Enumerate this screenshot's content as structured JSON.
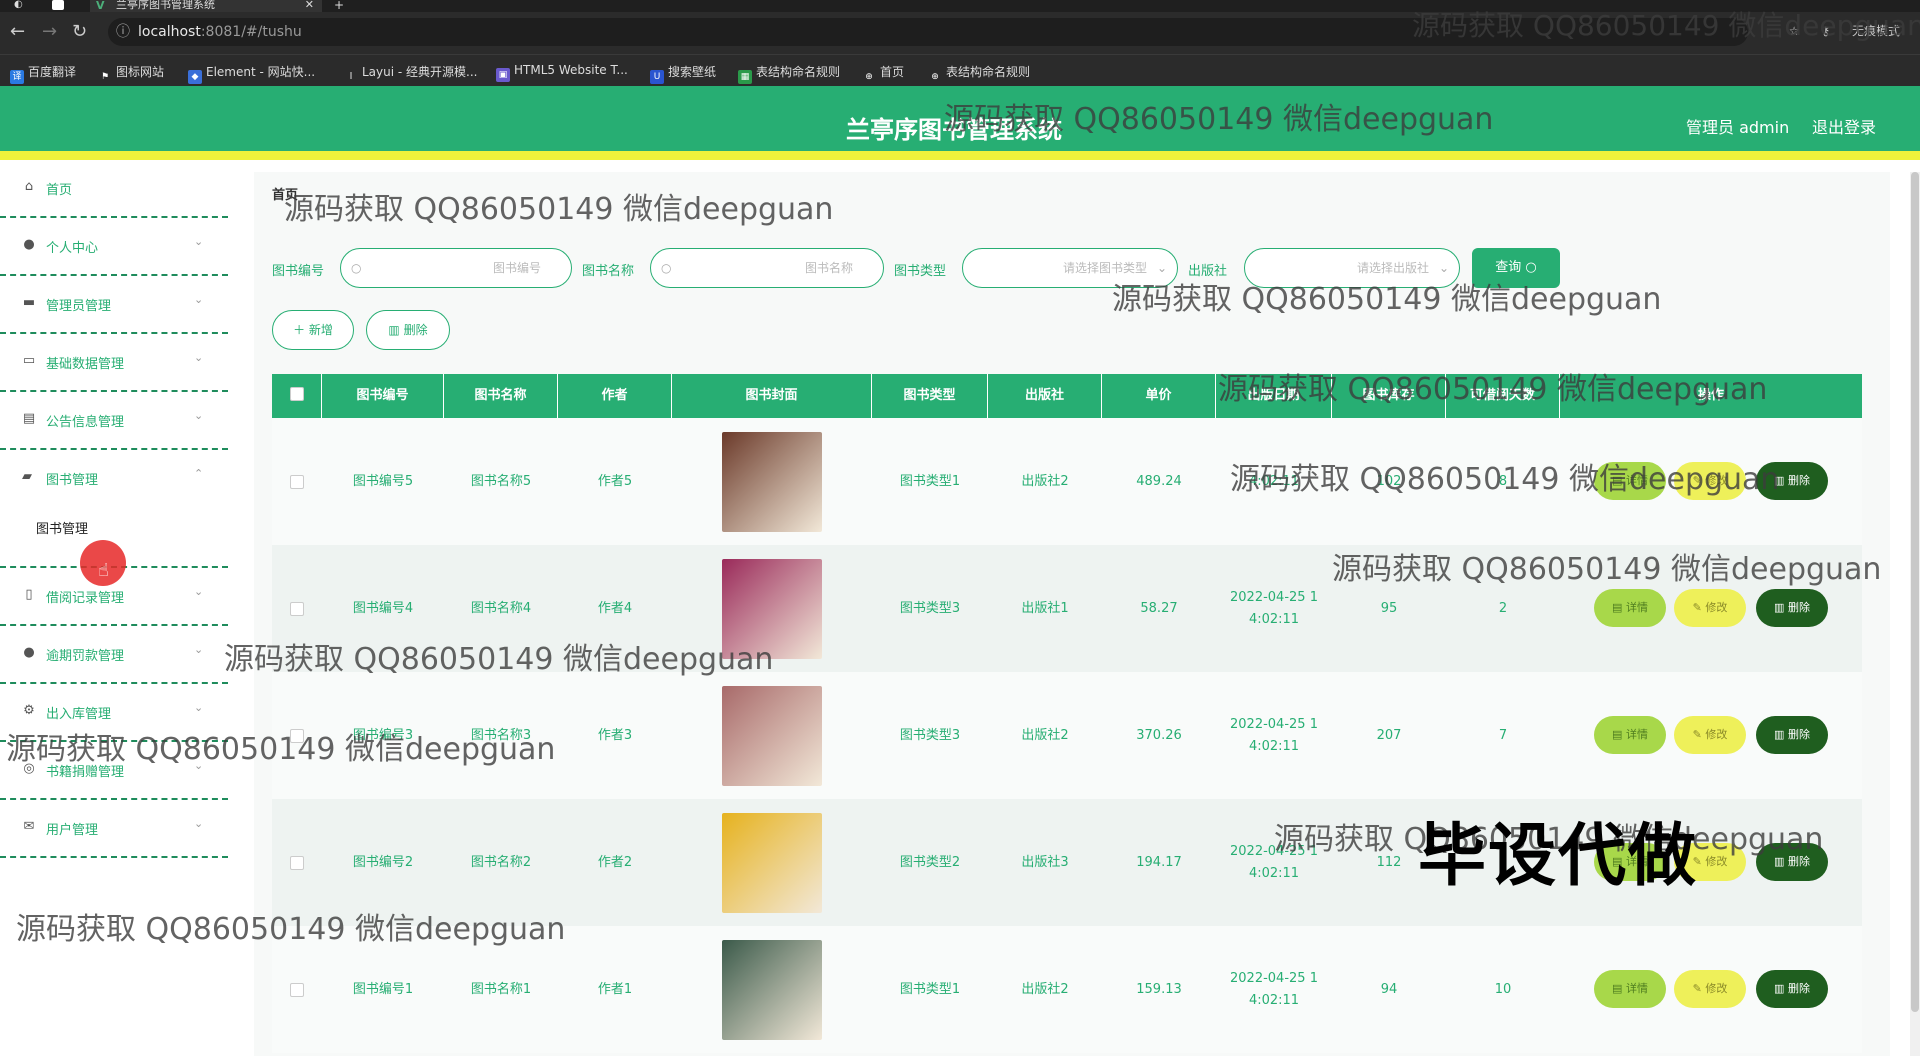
{
  "browser": {
    "tab_title": "兰亭序图书管理系统",
    "url_host": "localhost",
    "url_rest": ":8081/#/tushu",
    "profile": "无痕模式",
    "bookmarks": [
      "百度翻译",
      "图标网站",
      "Element - 网站快...",
      "Layui - 经典开源模...",
      "HTML5 Website T...",
      "搜索壁纸",
      "表结构命名规则",
      "首页",
      "表结构命名规则"
    ]
  },
  "header": {
    "title": "兰亭序图书管理系统",
    "admin": "管理员 admin",
    "logout": "退出登录"
  },
  "sidebar": {
    "items": [
      {
        "label": "首页"
      },
      {
        "label": "个人中心"
      },
      {
        "label": "管理员管理"
      },
      {
        "label": "基础数据管理"
      },
      {
        "label": "公告信息管理"
      },
      {
        "label": "图书管理"
      },
      {
        "label": "借阅记录管理"
      },
      {
        "label": "逾期罚款管理"
      },
      {
        "label": "出入库管理"
      },
      {
        "label": "书籍捐赠管理"
      },
      {
        "label": "用户管理"
      }
    ],
    "sub_item": "图书管理"
  },
  "breadcrumb": "首页",
  "filters": {
    "book_no_label": "图书编号",
    "book_no_placeholder": "图书编号",
    "book_name_label": "图书名称",
    "book_name_placeholder": "图书名称",
    "book_type_label": "图书类型",
    "book_type_placeholder": "请选择图书类型",
    "publisher_label": "出版社",
    "publisher_placeholder": "请选择出版社",
    "query": "查询"
  },
  "actions": {
    "add": "新增",
    "delete": "删除"
  },
  "table": {
    "columns": [
      "图书编号",
      "图书名称",
      "作者",
      "图书封面",
      "图书类型",
      "出版社",
      "单价",
      "出版日期",
      "图书库存",
      "可借阅天数",
      "操作"
    ],
    "row_actions": {
      "detail": "详情",
      "edit": "修改",
      "delete": "删除"
    },
    "rows": [
      {
        "no": "图书编号5",
        "name": "图书名称5",
        "author": "作者5",
        "type": "图书类型1",
        "publisher": "出版社2",
        "price": "489.24",
        "date_a": "",
        "date_b": "4:02:11",
        "stock": "102",
        "days": "8",
        "cover": "#6b3a2a"
      },
      {
        "no": "图书编号4",
        "name": "图书名称4",
        "author": "作者4",
        "type": "图书类型3",
        "publisher": "出版社1",
        "price": "58.27",
        "date_a": "2022-04-25 1",
        "date_b": "4:02:11",
        "stock": "95",
        "days": "2",
        "cover": "#9a2a5a"
      },
      {
        "no": "图书编号3",
        "name": "图书名称3",
        "author": "作者3",
        "type": "图书类型3",
        "publisher": "出版社2",
        "price": "370.26",
        "date_a": "2022-04-25 1",
        "date_b": "4:02:11",
        "stock": "207",
        "days": "7",
        "cover": "#a86a6a"
      },
      {
        "no": "图书编号2",
        "name": "图书名称2",
        "author": "作者2",
        "type": "图书类型2",
        "publisher": "出版社3",
        "price": "194.17",
        "date_a": "2022-04-25 1",
        "date_b": "4:02:11",
        "stock": "112",
        "days": "",
        "cover": "#e6b21e"
      },
      {
        "no": "图书编号1",
        "name": "图书名称1",
        "author": "作者1",
        "type": "图书类型1",
        "publisher": "出版社2",
        "price": "159.13",
        "date_a": "2022-04-25 1",
        "date_b": "4:02:11",
        "stock": "94",
        "days": "10",
        "cover": "#3b5a4a"
      }
    ]
  },
  "watermark": "源码获取 QQ86050149 微信deepguan",
  "watermark_big": "毕设代做",
  "colors": {
    "primary": "#27ae73",
    "accent_bar": "#eef23b"
  }
}
